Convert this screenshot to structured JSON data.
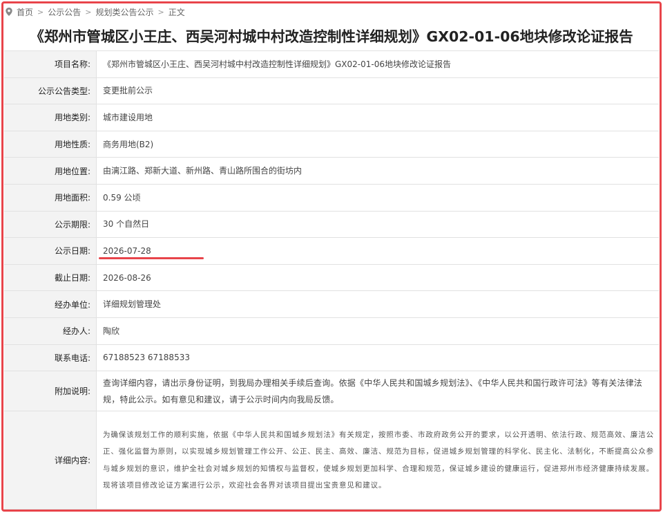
{
  "breadcrumb": {
    "icon": "location-pin-icon",
    "items": [
      "首页",
      "公示公告",
      "规划类公告公示",
      "正文"
    ],
    "separator": ">"
  },
  "title": "《郑州市管城区小王庄、西吴河村城中村改造控制性详细规划》GX02-01-06地块修改论证报告",
  "fields": {
    "project_name": {
      "label": "项目名称:",
      "value": "《郑州市管城区小王庄、西吴河村城中村改造控制性详细规划》GX02-01-06地块修改论证报告"
    },
    "notice_type": {
      "label": "公示公告类型:",
      "value": "变更批前公示"
    },
    "land_category": {
      "label": "用地类别:",
      "value": "城市建设用地"
    },
    "land_nature": {
      "label": "用地性质:",
      "value": "商务用地(B2)"
    },
    "land_location": {
      "label": "用地位置:",
      "value": "由漓江路、郑新大道、新州路、青山路所围合的街坊内"
    },
    "land_area": {
      "label": "用地面积:",
      "value": "0.59 公顷"
    },
    "notice_period": {
      "label": "公示期限:",
      "value": "30 个自然日"
    },
    "notice_date": {
      "label": "公示日期:",
      "value": "2026-07-28"
    },
    "deadline": {
      "label": "截止日期:",
      "value": "2026-08-26"
    },
    "handling_unit": {
      "label": "经办单位:",
      "value": "详细规划管理处"
    },
    "handler": {
      "label": "经办人:",
      "value": "陶欣"
    },
    "phone": {
      "label": "联系电话:",
      "value": "67188523 67188533"
    },
    "note": {
      "label": "附加说明:",
      "value": "查询详细内容，请出示身份证明，到我局办理相关手续后查询。依据《中华人民共和国城乡规划法》、《中华人民共和国行政许可法》等有关法律法规，特此公示。如有意见和建议，请于公示时间内向我局反馈。"
    },
    "detail": {
      "label": "详细内容:",
      "value": "为确保该规划工作的顺利实施，依据《中华人民共和国城乡规划法》有关规定，按照市委、市政府政务公开的要求，以公开透明、依法行政、规范高效、廉洁公正、强化监督为原则，以实现城乡规划管理工作公开、公正、民主、高效、廉洁、规范为目标，促进城乡规划管理的科学化、民主化、法制化，不断提高公众参与城乡规划的意识，维护全社会对城乡规划的知情权与监督权，使城乡规划更加科学、合理和规范，保证城乡建设的健康运行，促进郑州市经济健康持续发展。现将该项目修改论证方案进行公示，欢迎社会各界对该项目提出宝贵意见和建议。"
    }
  },
  "colors": {
    "highlight": "#e8444a",
    "label_bg": "#f3f3f3",
    "border": "#e1e1e1"
  }
}
